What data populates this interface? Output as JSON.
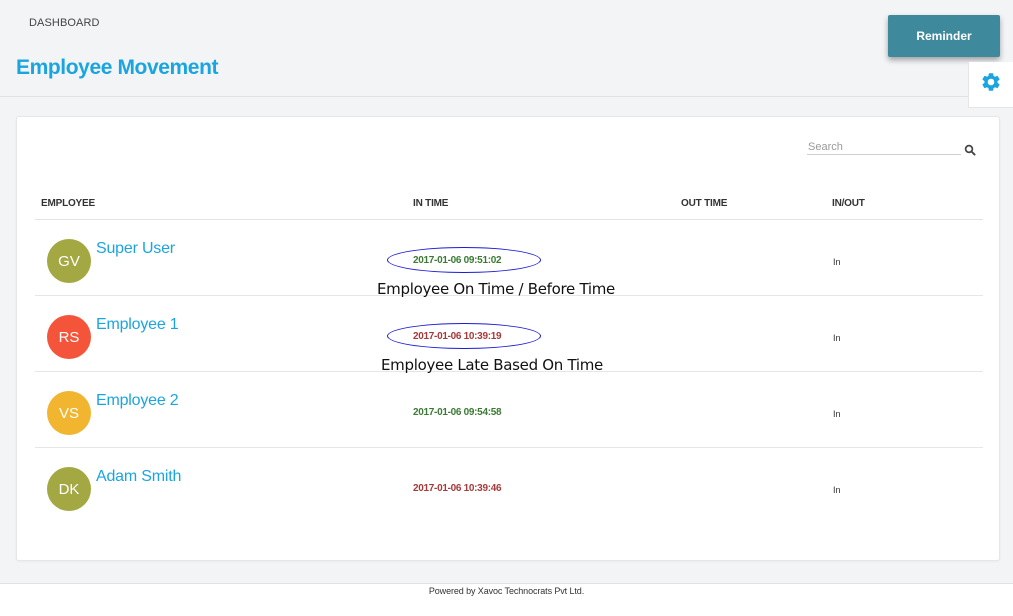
{
  "header": {
    "breadcrumb": "DASHBOARD",
    "title": "Employee Movement",
    "reminder_label": "Reminder",
    "settings_icon": "gear-icon"
  },
  "search": {
    "placeholder": "Search",
    "value": "",
    "icon": "search-icon"
  },
  "table": {
    "columns": [
      "EMPLOYEE",
      "IN TIME",
      "OUT TIME",
      "IN/OUT"
    ],
    "rows": [
      {
        "initials": "GV",
        "avatar_color": "#a3a843",
        "name": "Super User",
        "in_time": "2017-01-06 09:51:02",
        "in_time_status": "on-time",
        "out_time": "",
        "in_out": "In"
      },
      {
        "initials": "RS",
        "avatar_color": "#f4553a",
        "name": "Employee 1",
        "in_time": "2017-01-06 10:39:19",
        "in_time_status": "late",
        "out_time": "",
        "in_out": "In"
      },
      {
        "initials": "VS",
        "avatar_color": "#f2b52f",
        "name": "Employee 2",
        "in_time": "2017-01-06 09:54:58",
        "in_time_status": "on-time",
        "out_time": "",
        "in_out": "In"
      },
      {
        "initials": "DK",
        "avatar_color": "#a3a843",
        "name": "Adam Smith",
        "in_time": "2017-01-06 10:39:46",
        "in_time_status": "late",
        "out_time": "",
        "in_out": "In"
      }
    ]
  },
  "annotations": {
    "on_time": "Employee On Time / Before Time",
    "late": "Employee Late Based On Time"
  },
  "colors": {
    "accent": "#1ba5e0",
    "reminder_button": "#3e8a9c",
    "on_time": "#3a7a33",
    "late": "#a63a3a",
    "annotation_ellipse": "#1a1ad6"
  },
  "footer": {
    "text": "Powered by Xavoc Technocrats Pvt Ltd."
  }
}
